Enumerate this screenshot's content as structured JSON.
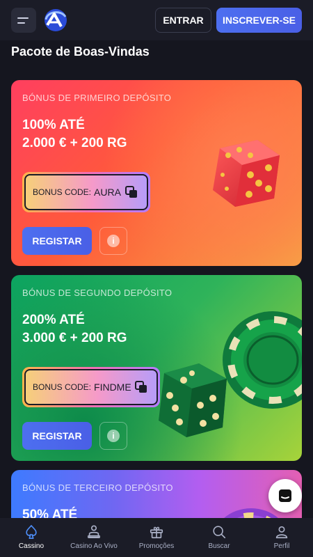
{
  "header": {
    "login_label": "ENTRAR",
    "signup_label": "INSCREVER-SE",
    "logo_text": "SA"
  },
  "page_title": "Pacote de Boas-Vindas",
  "cards": [
    {
      "tag": "BÓNUS DE PRIMEIRO DEPÓSITO",
      "line1": "100% ATÉ",
      "line2": "2.000 € + 200 RG",
      "code_label": "BONUS CODE:",
      "code_value": "AURA",
      "register_label": "REGISTAR"
    },
    {
      "tag": "BÓNUS DE SEGUNDO DEPÓSITO",
      "line1": "200% ATÉ",
      "line2": "3.000 € + 200 RG",
      "code_label": "BONUS CODE:",
      "code_value": "FINDME",
      "register_label": "REGISTAR"
    },
    {
      "tag": "BÓNUS DE TERCEIRO DEPÓSITO",
      "line1": "50% ATÉ"
    }
  ],
  "bottom_nav": [
    {
      "label": "Cassino",
      "icon": "spade-icon",
      "active": true
    },
    {
      "label": "Casino Ao Vivo",
      "icon": "dealer-icon",
      "active": false
    },
    {
      "label": "Promoções",
      "icon": "gift-icon",
      "active": false
    },
    {
      "label": "Buscar",
      "icon": "search-icon",
      "active": false
    },
    {
      "label": "Perfil",
      "icon": "user-icon",
      "active": false
    }
  ],
  "colors": {
    "background": "#15161f",
    "header": "#1b1c27",
    "accent_blue": "#4d6ff0"
  }
}
